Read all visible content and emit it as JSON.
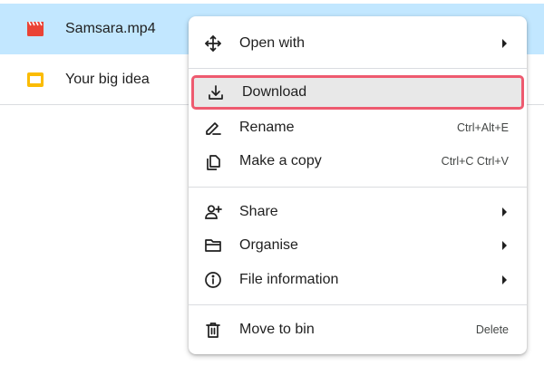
{
  "files": [
    {
      "name": "Samsara.mp4",
      "icon": "video-file-icon",
      "color": "#ea4335",
      "selected": true
    },
    {
      "name": "Your big idea",
      "icon": "slides-file-icon",
      "color": "#fbbc04",
      "selected": false
    }
  ],
  "menu": {
    "open_with": {
      "label": "Open with",
      "icon": "open-with-icon"
    },
    "download": {
      "label": "Download",
      "icon": "download-icon",
      "highlight_color": "#ee5a6f"
    },
    "rename": {
      "label": "Rename",
      "shortcut": "Ctrl+Alt+E",
      "icon": "rename-pencil-icon"
    },
    "copy": {
      "label": "Make a copy",
      "shortcut": "Ctrl+C Ctrl+V",
      "icon": "copy-icon"
    },
    "share": {
      "label": "Share",
      "icon": "share-person-add-icon"
    },
    "organise": {
      "label": "Organise",
      "icon": "folder-icon"
    },
    "info": {
      "label": "File information",
      "icon": "info-icon"
    },
    "bin": {
      "label": "Move to bin",
      "shortcut": "Delete",
      "icon": "trash-icon"
    }
  },
  "colors": {
    "selected_row": "#c2e7ff",
    "text": "#1f1f1f"
  }
}
